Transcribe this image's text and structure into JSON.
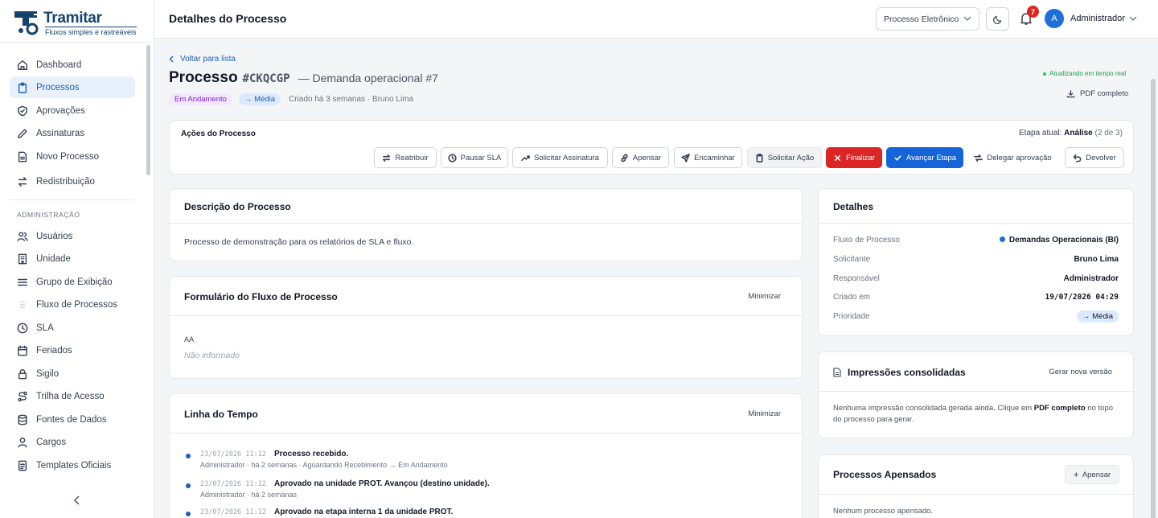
{
  "brand": {
    "name": "Tramitar",
    "tagline": "Fluxos simples e rastreáveis",
    "color": "#14436e"
  },
  "sidebar": {
    "items": [
      {
        "label": "Dashboard",
        "icon": "home-icon"
      },
      {
        "label": "Processos",
        "icon": "clipboard-icon",
        "active": true
      },
      {
        "label": "Aprovações",
        "icon": "shield-check-icon"
      },
      {
        "label": "Assinaturas",
        "icon": "pen-icon"
      },
      {
        "label": "Novo Processo",
        "icon": "file-icon"
      },
      {
        "label": "Redistribuição",
        "icon": "arrows-icon"
      }
    ],
    "admin_heading": "ADMINISTRAÇÃO",
    "admin_items": [
      {
        "label": "Usuários",
        "icon": "users-icon"
      },
      {
        "label": "Unidade",
        "icon": "building-icon"
      },
      {
        "label": "Grupo de Exibição",
        "icon": "menu-icon"
      },
      {
        "label": "Fluxo de Processos",
        "icon": "grid-dots-icon"
      },
      {
        "label": "SLA",
        "icon": "clock-icon"
      },
      {
        "label": "Feriados",
        "icon": "calendar-icon"
      },
      {
        "label": "Sigilo",
        "icon": "lock-icon"
      },
      {
        "label": "Trilha de Acesso",
        "icon": "route-icon"
      },
      {
        "label": "Fontes de Dados",
        "icon": "database-icon"
      },
      {
        "label": "Cargos",
        "icon": "user-icon"
      },
      {
        "label": "Templates Oficiais",
        "icon": "document-icon"
      }
    ]
  },
  "header": {
    "title": "Detalhes do Processo",
    "process_type": "Processo Eletrônico",
    "notifications": "7",
    "avatar_initial": "A",
    "user": "Administrador"
  },
  "process": {
    "back": "Voltar para lista",
    "title": "Processo",
    "code": "#CKQCGP",
    "subtitle": "— Demanda operacional #7",
    "status": "Em Andamento",
    "priority": "→ Média",
    "meta": "Criado há 3 semanas · Bruno Lima",
    "live": "Atualizando em tempo real",
    "pdf": "PDF completo"
  },
  "actions": {
    "title": "Ações do Processo",
    "stage_label": "Etapa atual:",
    "stage_name": "Análise",
    "stage_count": "(2 de 3)",
    "buttons": {
      "reassign": "Reatribuir",
      "pause": "Pausar SLA",
      "signature": "Solicitar Assinatura",
      "attach": "Apensar",
      "forward": "Encaminhar",
      "request": "Solicitar Ação",
      "finish": "Finalizar",
      "advance": "Avançar Etapa",
      "delegate": "Delegar aprovação",
      "return": "Devolver"
    }
  },
  "description": {
    "title": "Descrição do Processo",
    "text": "Processo de demonstração para os relatórios de SLA e fluxo."
  },
  "form": {
    "title": "Formulário do Fluxo de Processo",
    "minimize": "Minimizar",
    "field_label": "AA",
    "field_value": "Não informado"
  },
  "timeline": {
    "title": "Linha do Tempo",
    "minimize": "Minimizar",
    "events": [
      {
        "date": "23/07/2026 11:12",
        "message": "Processo recebido.",
        "detail": "Administrador · há 2 semanas · Aguardando Recebimento → Em Andamento"
      },
      {
        "date": "23/07/2026 11:12",
        "message": "Aprovado na unidade PROT. Avançou (destino unidade).",
        "detail": "Administrador · há 2 semanas"
      },
      {
        "date": "23/07/2026 11:12",
        "message": "Aprovado na etapa interna 1 da unidade PROT.",
        "detail": ""
      }
    ]
  },
  "details": {
    "title": "Detalhes",
    "rows": {
      "flow_label": "Fluxo de Processo",
      "flow_value": "Demandas Operacionais (BI)",
      "requester_label": "Solicitante",
      "requester_value": "Bruno Lima",
      "owner_label": "Responsável",
      "owner_value": "Administrador",
      "created_label": "Criado em",
      "created_value": "19/07/2026 04:29",
      "priority_label": "Prioridade",
      "priority_value": "→ Média"
    }
  },
  "prints": {
    "title": "Impressões consolidadas",
    "generate": "Gerar nova versão",
    "text_before": "Nenhuma impressão consolidada gerada ainda. Clique em ",
    "text_bold": "PDF completo",
    "text_after": " no topo do processo para gerar."
  },
  "attached": {
    "title": "Processos Apensados",
    "button": "Apensar",
    "empty": "Nenhum processo apensado."
  },
  "colors": {
    "accent": "#1e5fb4",
    "danger": "#dc2626",
    "primary": "#1565d8",
    "success": "#16a34a"
  }
}
